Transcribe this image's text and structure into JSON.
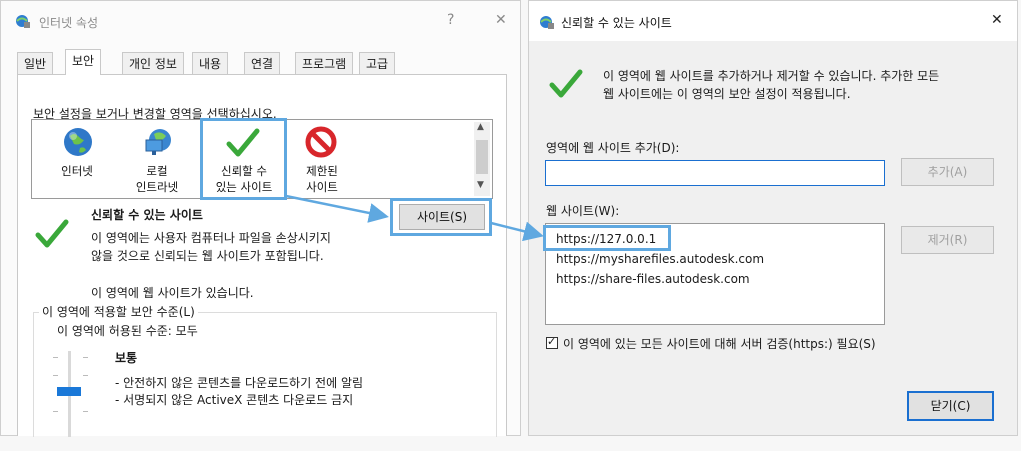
{
  "left_dialog": {
    "title": "인터넷 속성",
    "help_label": "?",
    "close_label": "✕",
    "tabs": [
      {
        "label": "일반"
      },
      {
        "label": "보안"
      },
      {
        "label": "개인 정보"
      },
      {
        "label": "내용"
      },
      {
        "label": "연결"
      },
      {
        "label": "프로그램"
      },
      {
        "label": "고급"
      }
    ],
    "instruction": "보안 설정을 보거나 변경할 영역을 선택하십시오.",
    "zones": [
      {
        "label_line1": "인터넷",
        "label_line2": "",
        "icon": "globe-icon"
      },
      {
        "label_line1": "로컬",
        "label_line2": "인트라넷",
        "icon": "intranet-icon"
      },
      {
        "label_line1": "신뢰할 수",
        "label_line2": "있는 사이트",
        "icon": "checkmark-icon"
      },
      {
        "label_line1": "제한된",
        "label_line2": "사이트",
        "icon": "restricted-icon"
      }
    ],
    "zone_title": "신뢰할 수 있는 사이트",
    "zone_desc_line1": "이 영역에는 사용자 컴퓨터나 파일을 손상시키지",
    "zone_desc_line2": "않을 것으로 신뢰되는 웹 사이트가 포함됩니다.",
    "sites_button": "사이트(S)",
    "zone_has_sites": "이 영역에 웹 사이트가 있습니다.",
    "security_level_group": "이 영역에 적용할 보안 수준(L)",
    "allowed_level": "이 영역에 허용된 수준: 모두",
    "level_name": "보통",
    "level_desc_line1": "- 안전하지 않은 콘텐츠를 다운로드하기 전에 알림",
    "level_desc_line2": "- 서명되지 않은 ActiveX 콘텐츠 다운로드 금지"
  },
  "right_dialog": {
    "title": "신뢰할 수 있는 사이트",
    "close_label": "✕",
    "info_line1": "이 영역에 웹 사이트를 추가하거나 제거할 수 있습니다. 추가한 모든",
    "info_line2": "웹 사이트에는 이 영역의 보안 설정이 적용됩니다.",
    "add_label": "영역에 웹 사이트 추가(D):",
    "add_input_value": "",
    "add_button": "추가(A)",
    "sites_label": "웹 사이트(W):",
    "sites": [
      "https://127.0.0.1",
      "https://mysharefiles.autodesk.com",
      "https://share-files.autodesk.com"
    ],
    "remove_button": "제거(R)",
    "checkbox_label": "이 영역에 있는 모든 사이트에 대해 서버 검증(https:) 필요(S)",
    "checkbox_checked": true,
    "close_button": "닫기(C)"
  },
  "colors": {
    "highlight": "#5fa8e0",
    "check_green": "#3aa83a",
    "restricted_red": "#d8262b"
  }
}
